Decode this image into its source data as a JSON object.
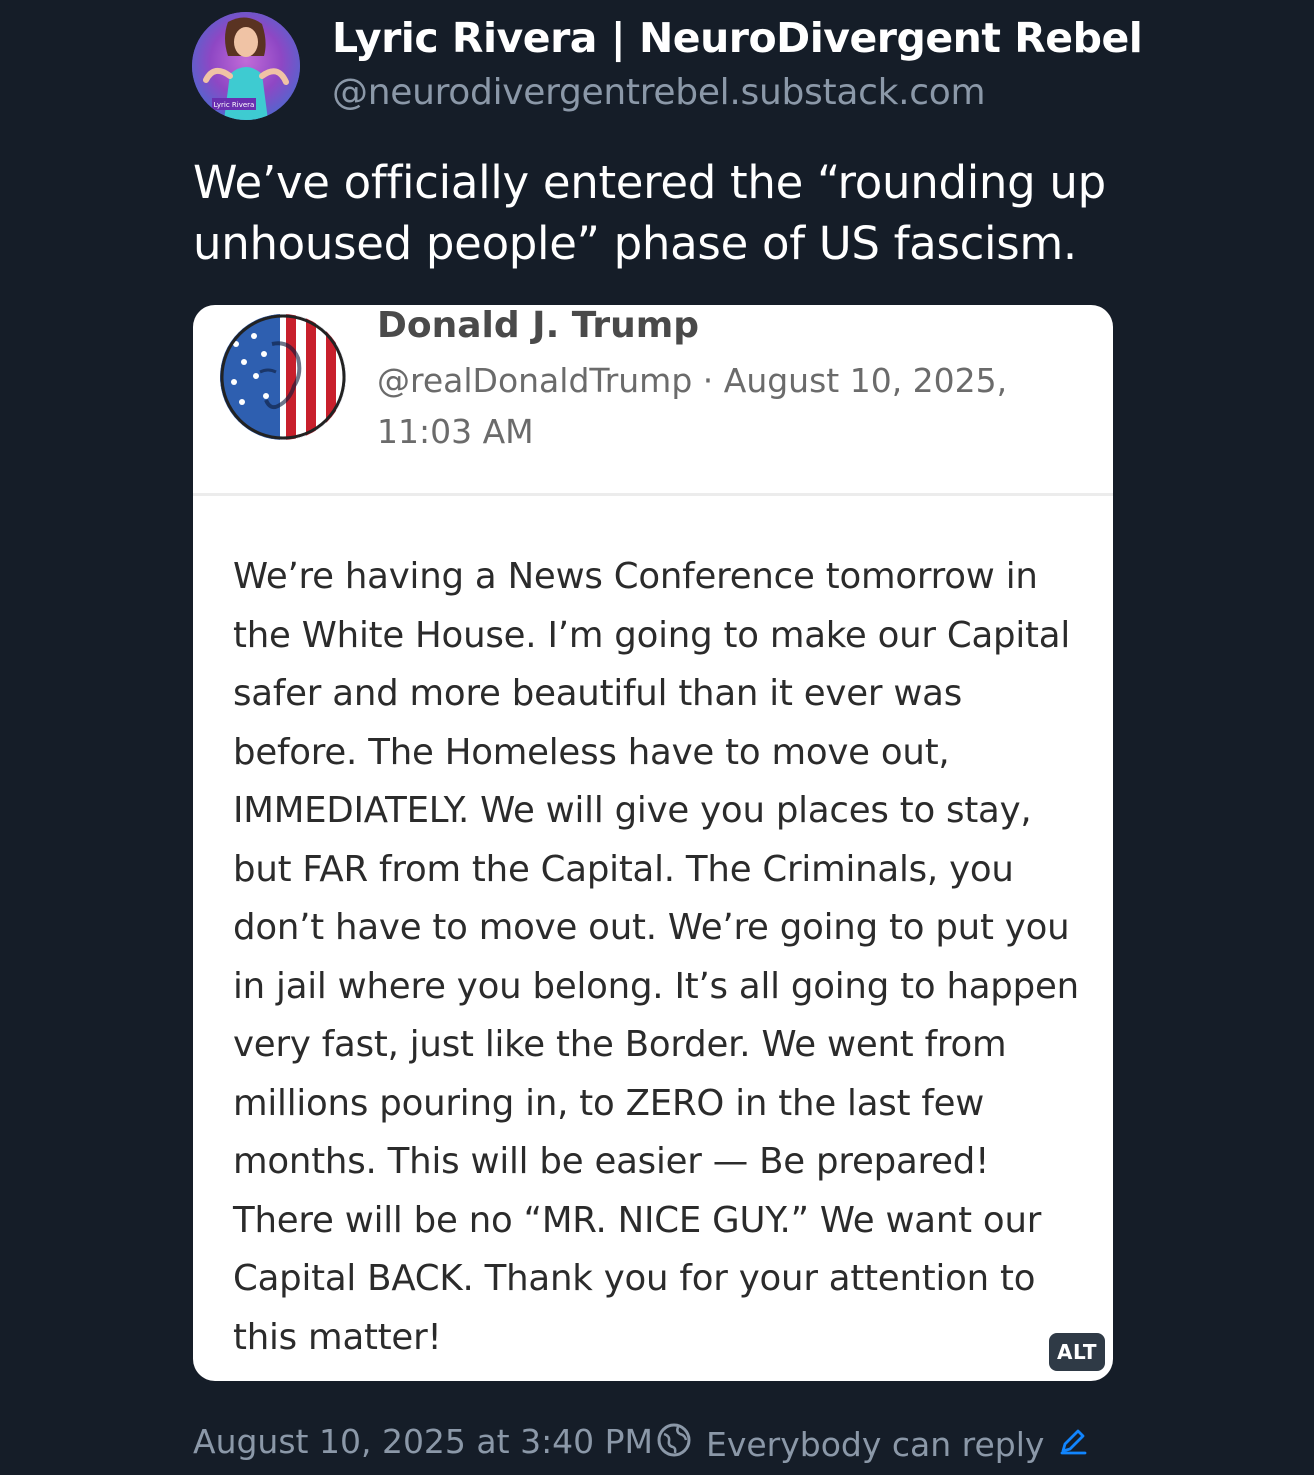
{
  "post": {
    "author": {
      "name": "Lyric Rivera | NeuroDivergent Rebel",
      "handle": "@neurodivergentrebel.substack.com",
      "avatar_caption": "Lyric Rivera"
    },
    "text": "We’ve officially entered the “rounding up unhoused people” phase of US fascism.",
    "embedded_image": {
      "author_name": "Donald J. Trump",
      "handle_and_date": "@realDonaldTrump · August 10, 2025, 11:03 AM",
      "body": "We’re having a News Conference tomorrow in the White House. I’m going to make our Capital safer and more beautiful than it ever was before. The Homeless have to move out, IMMEDIATELY. We will give you places to stay, but FAR from the Capital. The Criminals, you don’t have to move out. We’re going to put you in jail where you belong. It’s all going to happen very fast, just like the Border. We went from millions pouring in, to ZERO in the last few months. This will be easier — Be prepared! There will be no “MR. NICE GUY.” We want our Capital BACK. Thank you for your attention to this matter!",
      "alt_badge": "ALT"
    },
    "footer": {
      "timestamp": "August 10, 2025 at 3:40 PM",
      "reply_setting": "Everybody can reply"
    }
  },
  "colors": {
    "background": "#151d28",
    "muted_text": "#8b98a8",
    "accent": "#1185fe"
  },
  "icons": [
    "globe-icon",
    "pencil-icon"
  ]
}
